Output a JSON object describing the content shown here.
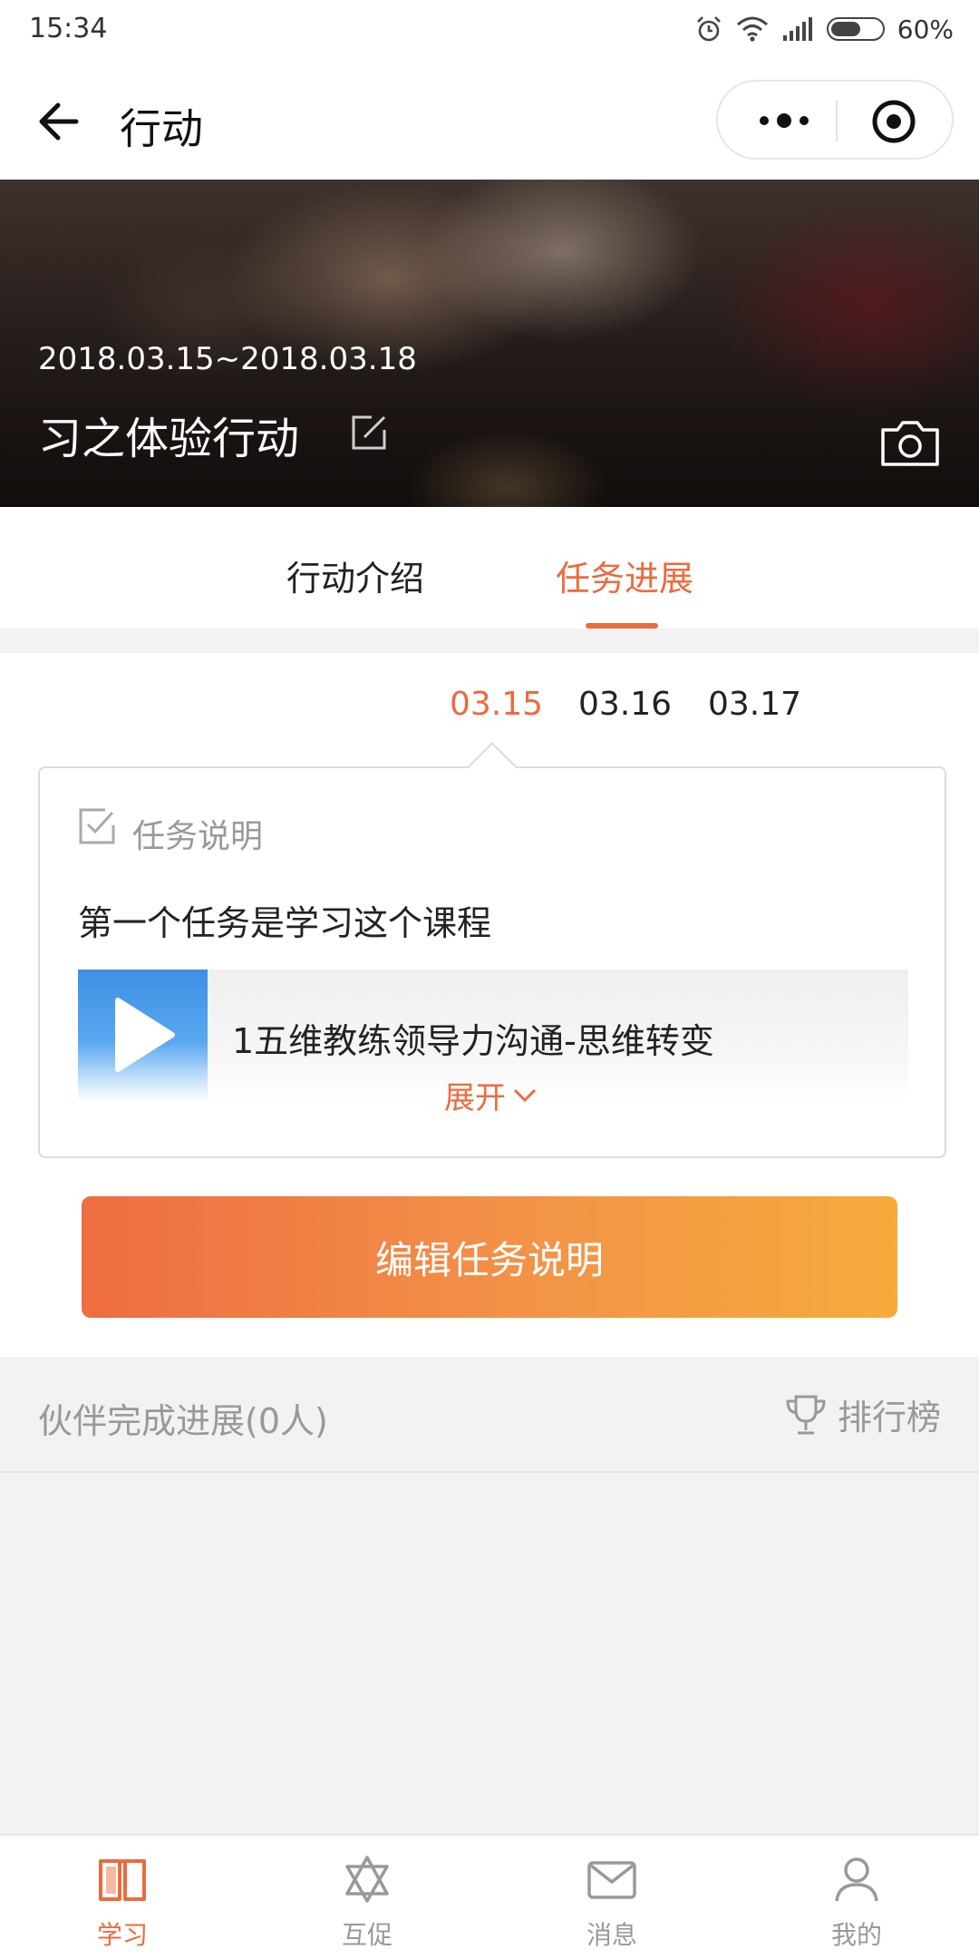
{
  "status_bar": {
    "time": "15:34",
    "battery": "60%",
    "battery_level": 0.6
  },
  "nav": {
    "title": "行动"
  },
  "banner": {
    "date_range": "2018.03.15~2018.03.18",
    "title": "习之体验行动"
  },
  "tabs": [
    {
      "label": "行动介绍",
      "active": false
    },
    {
      "label": "任务进展",
      "active": true
    }
  ],
  "dates": [
    {
      "label": "03.15",
      "active": true
    },
    {
      "label": "03.16",
      "active": false
    },
    {
      "label": "03.17",
      "active": false
    }
  ],
  "task": {
    "header_label": "任务说明",
    "description": "第一个任务是学习这个课程",
    "course_title": "1五维教练领导力沟通-思维转变",
    "expand_label": "展开"
  },
  "edit_button_label": "编辑任务说明",
  "partner": {
    "label": "伙伴完成进展(0人)",
    "ranking_label": "排行榜"
  },
  "bottom_nav": [
    {
      "label": "学习",
      "icon": "book-icon",
      "active": true
    },
    {
      "label": "互促",
      "icon": "triangles-icon",
      "active": false
    },
    {
      "label": "消息",
      "icon": "envelope-icon",
      "active": false
    },
    {
      "label": "我的",
      "icon": "person-icon",
      "active": false
    }
  ],
  "colors": {
    "accent": "#ec6b3e",
    "button_start": "#ee6d42",
    "button_end": "#f6ab3c",
    "muted": "#999999"
  }
}
